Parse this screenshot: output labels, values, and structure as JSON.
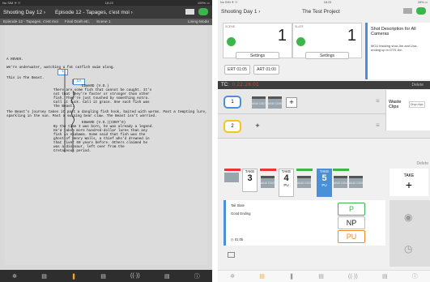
{
  "left": {
    "status": {
      "carrier": "No SIM ✈ ☉",
      "time": "18:23",
      "battery": "100% ▭"
    },
    "nav": {
      "back": "Shooting Day 12",
      "title": "Episode 12 - Tapages, c'est moi"
    },
    "crumbs": [
      "Episode 12 - Tapages, c'est moi",
      "Final Draft etc.",
      "Scene 1",
      "Lining Mode"
    ],
    "script": {
      "heading": "A ROVER.",
      "line1": "We're underwater, watching a fat catfish swim along.",
      "line2": "This is The Beast.",
      "cue1": "EDWARD (V.O.)",
      "d1": [
        "There are some fish that cannot be caught.  It's",
        "not that they're faster or stronger than other",
        "fish.  They're just touched by something extra.",
        "Call it luck.  Call it grace.  One such fish was",
        "The Beast."
      ],
      "action1": [
        "The Beast's journey takes it past a dangling fish hook, baited with worms.  Past a tempting lure,",
        "sparkling in the sun.  Past a swiping bear claw.  The Beast isn't worried."
      ],
      "cue2": "EDWARD (V.O.)(CONT'D)",
      "d2": [
        "By the time I was born, he was already a legend.",
        "He'd taken more hundred-dollar lures than any",
        "fish in Alabama. Some said that fish was the",
        "ghost of Henry Walls, a thief who'd drowned in",
        "that river 60 years before.  Others claimed he",
        "was a dinosaur, left over from the",
        "Cretaceous period."
      ],
      "box1": "1",
      "box2": "5A"
    },
    "tabs": [
      "✲",
      "▤",
      "❚",
      "▤",
      "((·))",
      "▤",
      "ⓘ"
    ]
  },
  "right": {
    "status": {
      "carrier": "No SIM ✈ ☉",
      "time": "18:23",
      "battery": "28% ▭"
    },
    "nav": {
      "back": "Shooting Day 1",
      "title": "The Test Project"
    },
    "scene": {
      "label": "SCENE",
      "number": "1",
      "settings": "Settings"
    },
    "slate": {
      "label": "SLATE",
      "number": "1",
      "settings": "Settings"
    },
    "ert": [
      "ERT 01:05",
      "ART 01:00"
    ],
    "shot": {
      "title": "Shot Description for All Cameras",
      "desc": "MCU tracking shot Jim and Lisa, ending up in OTS Jim"
    },
    "tc": {
      "label": "TC:",
      "value": "0:22:26:01",
      "delete": "Delete"
    },
    "cams": [
      {
        "n": "1",
        "clips": [
          "A040 C007",
          "A040 C006"
        ]
      },
      {
        "n": "2",
        "clips": []
      }
    ],
    "waste": {
      "label": "Waste Clips",
      "icon": "Drop clips"
    },
    "delete2": "Delete",
    "takes": [
      {
        "label": "TAKE",
        "n": "3",
        "pu": ""
      },
      {
        "label": "TAKE",
        "n": "4",
        "pu": "PU"
      },
      {
        "label": "TAKE",
        "n": "5",
        "pu": "PU"
      }
    ],
    "take_add": {
      "label": "TAKE",
      "sym": "+"
    },
    "clips2": [
      "A040 C002",
      "A040 C003",
      "A040 C004",
      "A040 C005"
    ],
    "notes": {
      "tail": "Tail Slate",
      "good": "Good Ending",
      "dur": "01:0b"
    },
    "rating": {
      "p": "P",
      "np": "NP",
      "pu": "PU"
    },
    "tabs": [
      "✲",
      "▤",
      "❚",
      "▤",
      "((·))",
      "▤",
      "ⓘ"
    ]
  }
}
